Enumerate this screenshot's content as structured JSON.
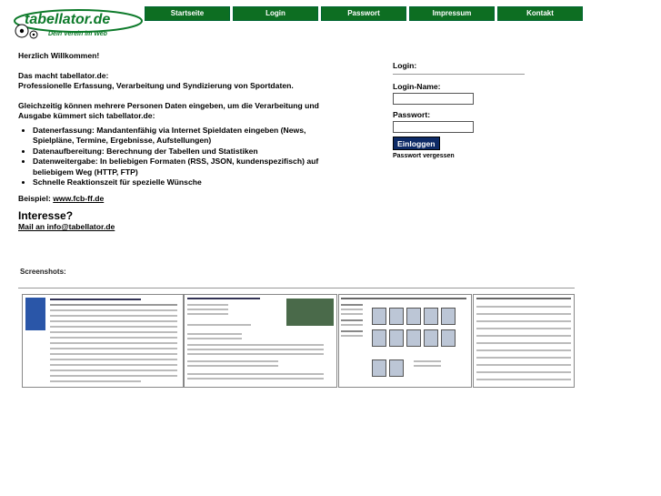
{
  "logo": {
    "name": "tabellator.de",
    "tagline": "Dein Verein im Web"
  },
  "nav": [
    "Startseite",
    "Login",
    "Passwort",
    "Impressum",
    "Kontakt"
  ],
  "main": {
    "welcome": "Herzlich Willkommen!",
    "what_title": "Das macht tabellator.de:",
    "what_text": "Professionelle Erfassung, Verarbeitung und Syndizierung von Sportdaten.",
    "multi": "Gleichzeitig können mehrere Personen Daten eingeben, um die Verarbeitung und Ausgabe kümmert sich tabellator.de:",
    "features": [
      "Datenerfassung: Mandantenfähig via Internet Spieldaten eingeben (News, Spielpläne, Termine, Ergebnisse, Aufstellungen)",
      "Datenaufbereitung: Berechnung der Tabellen und Statistiken",
      "Datenweitergabe: In beliebigen Formaten (RSS, JSON, kundenspezifisch) auf beliebigem Weg (HTTP, FTP)",
      "Schnelle Reaktionszeit für spezielle Wünsche"
    ],
    "example_label": "Beispiel:",
    "example_link": "www.fcb-ff.de",
    "interest": "Interesse?",
    "mail_link": "Mail an info@tabellator.de",
    "screenshots": "Screenshots:"
  },
  "login": {
    "title": "Login:",
    "name_label": "Login-Name:",
    "password_label": "Passwort:",
    "submit": "Einloggen",
    "forgot": "Passwort vergessen"
  },
  "colors": {
    "nav_bg": "#0d6e22",
    "button_bg": "#0d2a66",
    "logo_green": "#0d7a2a"
  }
}
